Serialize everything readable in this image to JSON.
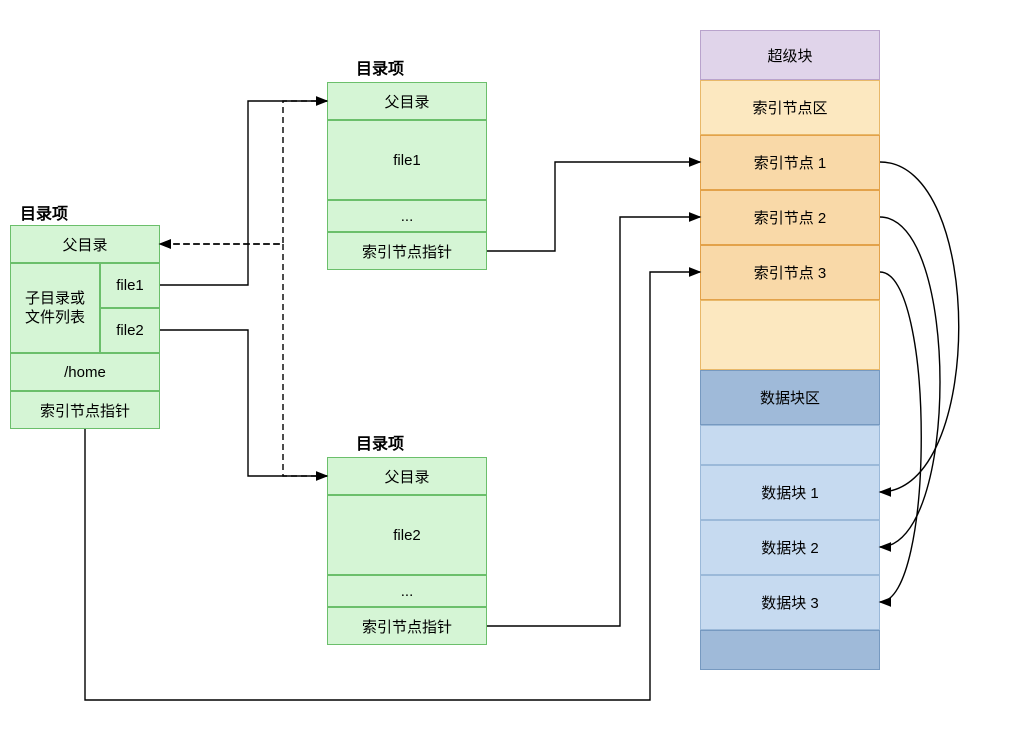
{
  "diagram": {
    "dirEntry": {
      "title": "目录项",
      "parent": "父目录",
      "childrenLabel": "子目录或\n文件列表",
      "file1": "file1",
      "file2": "file2",
      "home": "/home",
      "inodePtr": "索引节点指针"
    },
    "dirEntryFile1": {
      "title": "目录项",
      "parent": "父目录",
      "name": "file1",
      "ellipsis": "...",
      "inodePtr": "索引节点指针"
    },
    "dirEntryFile2": {
      "title": "目录项",
      "parent": "父目录",
      "name": "file2",
      "ellipsis": "...",
      "inodePtr": "索引节点指针"
    },
    "disk": {
      "superBlock": "超级块",
      "inodeArea": "索引节点区",
      "inode1": "索引节点 1",
      "inode2": "索引节点 2",
      "inode3": "索引节点 3",
      "dataArea": "数据块区",
      "data1": "数据块 1",
      "data2": "数据块 2",
      "data3": "数据块 3"
    }
  }
}
